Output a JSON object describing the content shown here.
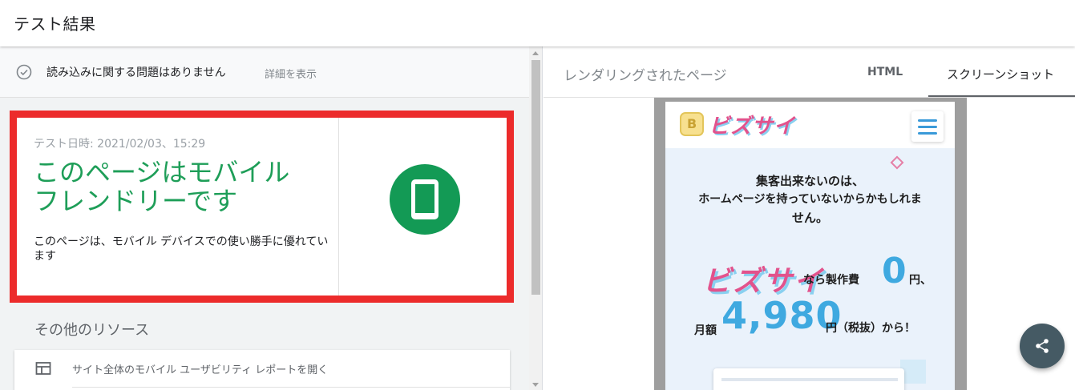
{
  "header": {
    "title": "テスト結果"
  },
  "status": {
    "text": "読み込みに関する問題はありません",
    "details_link": "詳細を表示",
    "icon": "check-circle-icon"
  },
  "result": {
    "test_date": "テスト日時: 2021/02/03、15:29",
    "verdict_line1": "このページはモバイル",
    "verdict_line2": "フレンドリーです",
    "description": "このページは、モバイル デバイスでの使い勝手に優れています",
    "icon": "smartphone-icon",
    "highlight_color": "#ec2b2b",
    "verdict_color": "#1e9e58"
  },
  "other_resources": {
    "title": "その他のリソース",
    "items": [
      {
        "label": "サイト全体のモバイル ユーザビリティ レポートを開く",
        "icon": "web-layout-icon"
      }
    ]
  },
  "rendered": {
    "title": "レンダリングされたページ",
    "tabs": [
      {
        "label": "HTML",
        "active": false
      },
      {
        "label": "スクリーンショット",
        "active": true
      }
    ]
  },
  "screenshot": {
    "logo_letter": "B",
    "logo_text": "ビズサイ",
    "hero_line1": "集客出来ないのは、",
    "hero_line2": "ホームページを持っていないからかもしれま",
    "hero_line3": "せん。",
    "brand": "ビズサイ",
    "text_cost": "なら製作費",
    "zero": "0",
    "yen_comma": "円、",
    "monthly": "月額",
    "price": "4,980",
    "tail": "円（税抜）から！"
  },
  "share": {
    "icon": "share-icon"
  }
}
